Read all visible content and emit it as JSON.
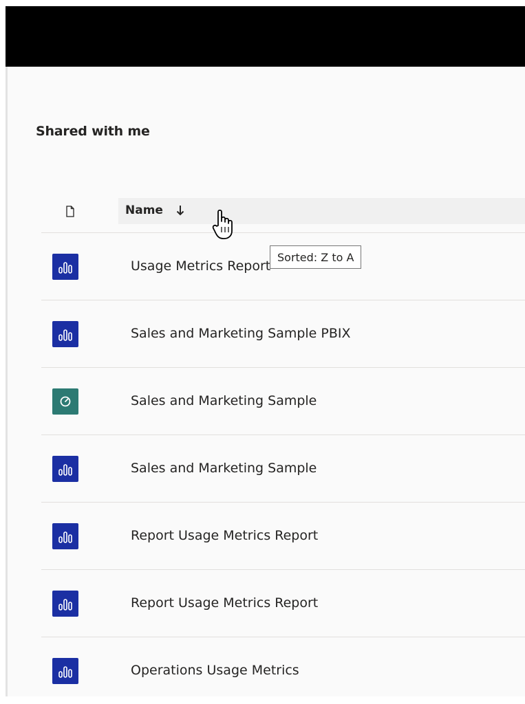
{
  "page": {
    "title": "Shared with me"
  },
  "table": {
    "name_header": "Name",
    "sort_indicator": "arrow-down-icon",
    "tooltip": "Sorted: Z to A",
    "rows": [
      {
        "name": "Usage Metrics Report",
        "type": "report",
        "icon": "report-icon"
      },
      {
        "name": "Sales and Marketing Sample PBIX",
        "type": "report",
        "icon": "report-icon"
      },
      {
        "name": "Sales and Marketing Sample",
        "type": "dashboard",
        "icon": "dashboard-icon"
      },
      {
        "name": "Sales and Marketing Sample",
        "type": "report",
        "icon": "report-icon"
      },
      {
        "name": "Report Usage Metrics Report",
        "type": "report",
        "icon": "report-icon"
      },
      {
        "name": "Report Usage Metrics Report",
        "type": "report",
        "icon": "report-icon"
      },
      {
        "name": "Operations Usage Metrics",
        "type": "report",
        "icon": "report-icon"
      }
    ]
  },
  "colors": {
    "report_tile": "#1b2fa3",
    "dashboard_tile": "#2c7a73",
    "header_bar": "#000000"
  }
}
